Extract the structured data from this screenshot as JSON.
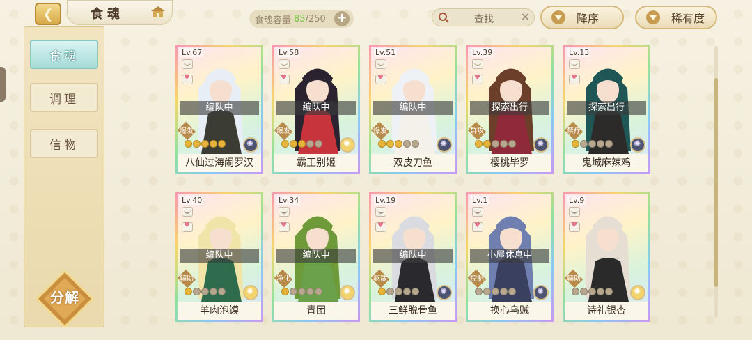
{
  "header": {
    "back_icon": "chevron-left-icon",
    "title": "食魂",
    "home_icon": "pavilion-icon",
    "capacity_label": "食魂容量",
    "capacity_used": "85",
    "capacity_total": "/250",
    "add_label": "+",
    "search_placeholder": "查找",
    "search_clear": "✕",
    "sort_order_label": "降序",
    "sort_rarity_label": "稀有度"
  },
  "sidebar": {
    "tabs": [
      {
        "label": "食魂",
        "active": true
      },
      {
        "label": "调理",
        "active": false
      },
      {
        "label": "信物",
        "active": false
      }
    ],
    "decompose_label": "分解"
  },
  "colors": {
    "accent_teal": "#a7dbd8",
    "gold": "#d8a948",
    "panel_bg": "#ead9ad"
  },
  "cards": [
    {
      "level": "Lv.67",
      "status": "编队中",
      "role": "爆发",
      "name": "八仙过海闹罗汉",
      "stars_on": 5,
      "stars_total": 5,
      "element": "dark",
      "hair": "#e8eef6",
      "robe": "#3b3d34"
    },
    {
      "level": "Lv.58",
      "status": "编队中",
      "role": "爆发",
      "name": "霸王别姬",
      "stars_on": 3,
      "stars_total": 5,
      "element": "gold",
      "hair": "#2b2430",
      "robe": "#c7343b"
    },
    {
      "level": "Lv.51",
      "status": "编队中",
      "role": "爆发",
      "name": "双皮刀鱼",
      "stars_on": 3,
      "stars_total": 5,
      "element": "dark",
      "hair": "#eef2f6",
      "robe": "#f4f1ea"
    },
    {
      "level": "Lv.39",
      "status": "探索出行",
      "role": "群攻",
      "name": "樱桃毕罗",
      "stars_on": 2,
      "stars_total": 5,
      "element": "dark",
      "hair": "#6b3f2a",
      "robe": "#8e2a3a"
    },
    {
      "level": "Lv.13",
      "status": "探索出行",
      "role": "禁疗",
      "name": "鬼城麻辣鸡",
      "stars_on": 1,
      "stars_total": 5,
      "element": "dark",
      "hair": "#1f5656",
      "robe": "#2d2a2a"
    },
    {
      "level": "Lv.40",
      "status": "编队中",
      "role": "辅助",
      "name": "羊肉泡馍",
      "stars_on": 1,
      "stars_total": 5,
      "element": "gold",
      "hair": "#f0e4a8",
      "robe": "#2f6b4d"
    },
    {
      "level": "Lv.34",
      "status": "编队中",
      "role": "净化",
      "name": "青团",
      "stars_on": 1,
      "stars_total": 5,
      "element": "gold",
      "hair": "#6f9a3a",
      "robe": "#6aa14a"
    },
    {
      "level": "Lv.19",
      "status": "编队中",
      "role": "驱散",
      "name": "三鲜脱骨鱼",
      "stars_on": 1,
      "stars_total": 5,
      "element": "dark",
      "hair": "#d9dbe0",
      "robe": "#2a2a2e"
    },
    {
      "level": "Lv.1",
      "status": "小屋休息中",
      "role": "控制",
      "name": "换心乌贼",
      "stars_on": 0,
      "stars_total": 5,
      "element": "dark",
      "hair": "#6f7fb0",
      "robe": "#3a4060"
    },
    {
      "level": "Lv.9",
      "status": "",
      "role": "辅助",
      "name": "诗礼银杏",
      "stars_on": 0,
      "stars_total": 5,
      "element": "gold",
      "hair": "#e6ded2",
      "robe": "#2a2a2a"
    }
  ]
}
